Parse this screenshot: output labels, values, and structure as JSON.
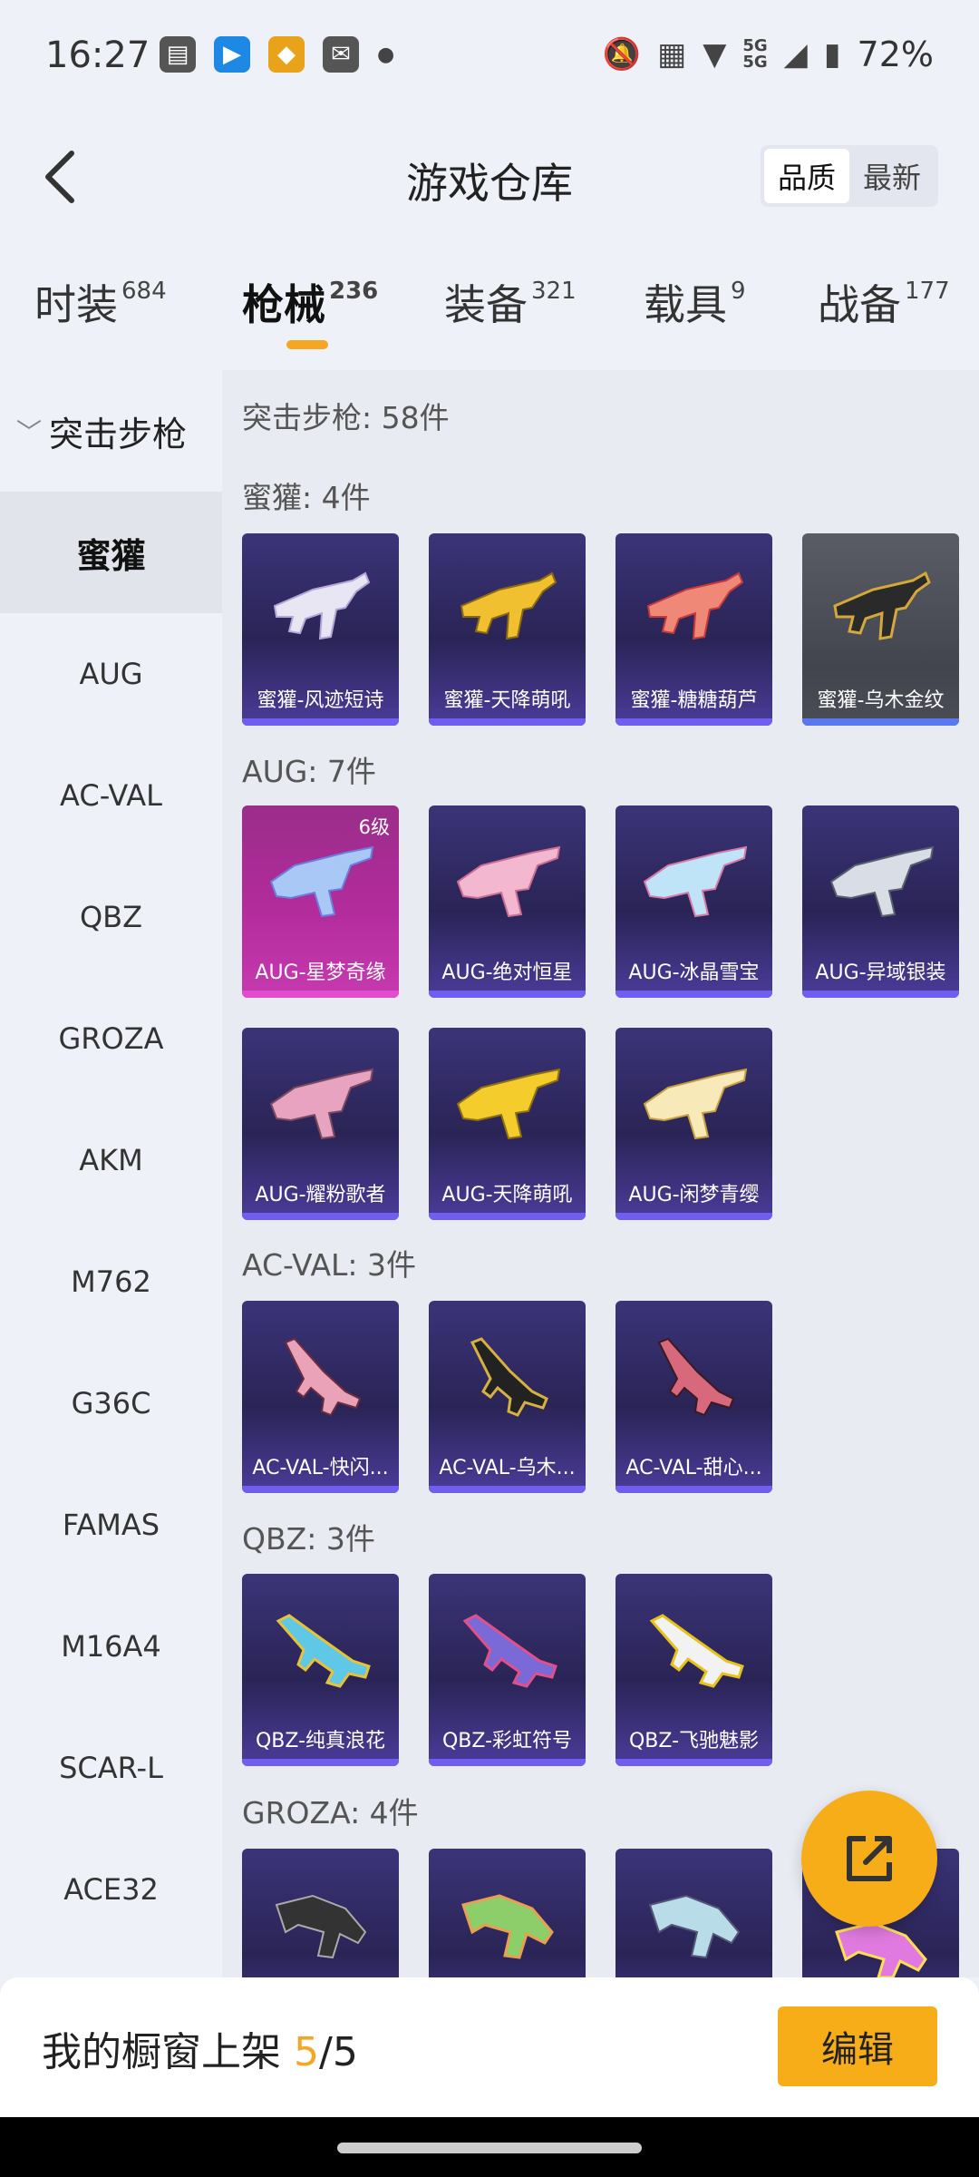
{
  "status_bar": {
    "time": "16:27",
    "battery": "72%",
    "net_top": "5G",
    "net_bottom": "5G"
  },
  "header": {
    "title": "游戏仓库",
    "sort_quality": "品质",
    "sort_latest": "最新"
  },
  "tabs": [
    {
      "label": "时装",
      "count": "684"
    },
    {
      "label": "枪械",
      "count": "236"
    },
    {
      "label": "装备",
      "count": "321"
    },
    {
      "label": "载具",
      "count": "9"
    },
    {
      "label": "战备",
      "count": "177"
    }
  ],
  "sidebar": {
    "group": "突击步枪",
    "items": [
      "蜜獾",
      "AUG",
      "AC-VAL",
      "QBZ",
      "GROZA",
      "AKM",
      "M762",
      "G36C",
      "FAMAS",
      "M16A4",
      "SCAR-L",
      "ACE32"
    ]
  },
  "content": {
    "total": "突击步枪: 58件",
    "sections": [
      {
        "title": "蜜獾: 4件",
        "cards": [
          "蜜獾-风迹短诗",
          "蜜獾-天降萌吼",
          "蜜獾-糖糖葫芦",
          "蜜獾-乌木金纹"
        ]
      },
      {
        "title": "AUG: 7件",
        "level": "6级",
        "cards": [
          "AUG-星梦奇缘",
          "AUG-绝对恒星",
          "AUG-冰晶雪宝",
          "AUG-异域银装",
          "AUG-耀粉歌者",
          "AUG-天降萌吼",
          "AUG-闲梦青缨"
        ]
      },
      {
        "title": "AC-VAL: 3件",
        "cards": [
          "AC-VAL-快闪...",
          "AC-VAL-乌木...",
          "AC-VAL-甜心..."
        ]
      },
      {
        "title": "QBZ: 3件",
        "cards": [
          "QBZ-纯真浪花",
          "QBZ-彩虹符号",
          "QBZ-飞驰魅影"
        ]
      },
      {
        "title": "GROZA: 4件",
        "cards": []
      }
    ]
  },
  "bottom": {
    "window_label": "我的橱窗上架 ",
    "window_current": "5",
    "window_total": "/5",
    "edit": "编辑"
  },
  "colors": {
    "accent": "#f5a623",
    "card_purple": "#2a2456",
    "card_pink": "#b32c9c"
  }
}
